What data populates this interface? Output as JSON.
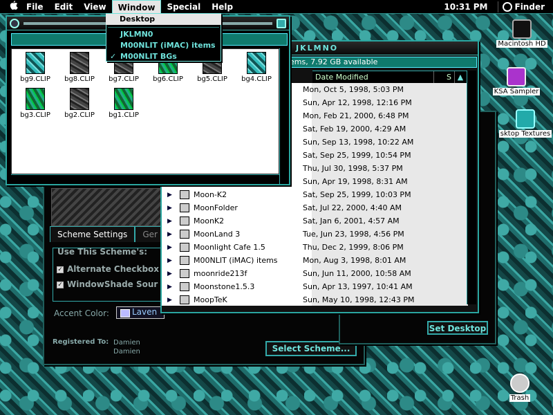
{
  "menubar": {
    "apple": "",
    "items": [
      "File",
      "Edit",
      "View",
      "Window",
      "Special",
      "Help"
    ],
    "clock": "10:31 PM",
    "app": "Finder"
  },
  "window_menu": {
    "items": [
      {
        "label": "Desktop",
        "checked": false,
        "highlighted": true
      },
      {
        "label": "JKLMN0",
        "checked": false,
        "highlighted": false
      },
      {
        "label": "M00NLIT (iMAC) items",
        "checked": false,
        "highlighted": false
      },
      {
        "label": "M00NLIT BGs",
        "checked": true,
        "highlighted": false
      }
    ]
  },
  "desktop_icons": [
    {
      "label": "Macintosh HD"
    },
    {
      "label": "KSA Sampler"
    },
    {
      "label": "sktop Textures"
    },
    {
      "label": "Trash"
    }
  ],
  "front_window": {
    "files": [
      "bg9.CLIP",
      "bg8.CLIP",
      "bg7.CLIP",
      "bg6.CLIP",
      "bg5.CLIP",
      "bg4.CLIP",
      "bg3.CLIP",
      "bg2.CLIP",
      "bg1.CLIP"
    ]
  },
  "list_window": {
    "title": "JKLMNO",
    "status": "ems, 7.92 GB available",
    "columns": [
      "Date Modified",
      "S"
    ],
    "rows": [
      {
        "name": "",
        "date": "Mon, Oct 5, 1998, 5:03 PM"
      },
      {
        "name": "",
        "date": "Sun, Apr 12, 1998, 12:16 PM"
      },
      {
        "name": "",
        "date": "Mon, Feb 21, 2000, 6:48 PM"
      },
      {
        "name": "",
        "date": "Sat, Feb 19, 2000, 4:29 AM"
      },
      {
        "name": "",
        "date": "Sun, Sep 13, 1998, 10:22 AM"
      },
      {
        "name": "",
        "date": "Sat, Sep 25, 1999, 10:54 PM"
      },
      {
        "name": "",
        "date": "Thu, Jul 30, 1998, 5:37 PM"
      },
      {
        "name": "",
        "date": "Sun, Apr 19, 1998, 8:31 AM"
      },
      {
        "name": "Moon-K2",
        "date": "Sat, Sep 25, 1999, 10:03 PM"
      },
      {
        "name": "MoonFolder",
        "date": "Sat, Jul 22, 2000, 4:40 AM"
      },
      {
        "name": "MoonK2",
        "date": "Sat, Jan 6, 2001, 4:57 AM"
      },
      {
        "name": "MoonLand 3",
        "date": "Tue, Jun 23, 1998, 4:56 PM"
      },
      {
        "name": "Moonlight Cafe 1.5",
        "date": "Thu, Dec 2, 1999, 8:06 PM"
      },
      {
        "name": "M00NLIT (iMAC) items",
        "date": "Mon, Aug 3, 1998, 8:01 AM"
      },
      {
        "name": "moonride213f",
        "date": "Sun, Jun 11, 2000, 10:58 AM"
      },
      {
        "name": "Moonstone1.5.3",
        "date": "Sun, Apr 13, 1997, 10:41 AM"
      },
      {
        "name": "MoopTeK",
        "date": "Sun, May 10, 1998, 12:43 PM"
      }
    ],
    "set_desktop": "Set Desktop"
  },
  "appearance": {
    "tabs": [
      "Scheme Settings",
      "Ger"
    ],
    "group_label": "Use This Scheme's:",
    "checkboxes": [
      "Alternate Checkbox",
      "WindowShade Sour"
    ],
    "accent_label": "Accent Color:",
    "accent_value": "Laven",
    "registered_label": "Registered To:",
    "registered_lines": [
      "Damien",
      "Damien"
    ],
    "select_button": "Select Scheme..."
  }
}
